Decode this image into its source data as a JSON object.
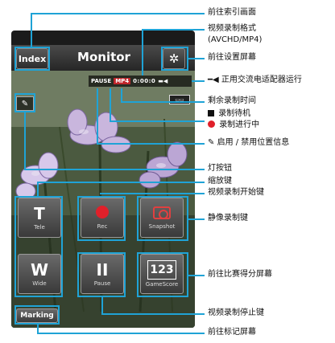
{
  "screen": {
    "title": "Monitor",
    "index_label": "Index",
    "gear_icon": "gear-icon",
    "status": {
      "pause_text": "PAUSE",
      "format_text": "MP4",
      "time_text": "0:00:0",
      "power_icon": "ac-adapter-icon"
    },
    "remaining_label": "",
    "buttons": {
      "tele": {
        "glyph": "T",
        "caption": "Tele"
      },
      "wide": {
        "glyph": "W",
        "caption": "Wide"
      },
      "rec": {
        "caption": "Rec"
      },
      "pause": {
        "glyph": "II",
        "caption": "Pause"
      },
      "snapshot": {
        "caption": "Snapshot"
      },
      "gamescore": {
        "glyph": "123",
        "caption": "GameScore"
      }
    },
    "marking_label": "Marking"
  },
  "callouts": {
    "index": "前往索引画面",
    "format_line1": "视频录制格式",
    "format_line2": "(AVCHD/MP4)",
    "settings": "前往设置屏幕",
    "ac_adapter": "正用交流电适配器运行",
    "remaining": "剩余录制时间",
    "standby": "录制待机",
    "recording": "录制进行中",
    "location": "启用 / 禁用位置信息",
    "light": "灯按钮",
    "zoom": "缩放键",
    "rec_start": "视频录制开始键",
    "still": "静像录制键",
    "gamescore": "前往比赛得分屏幕",
    "rec_stop": "视频录制停止键",
    "marking": "前往标记屏幕"
  },
  "colors": {
    "accent": "#1fa3d6",
    "record_red": "#e0202a"
  }
}
